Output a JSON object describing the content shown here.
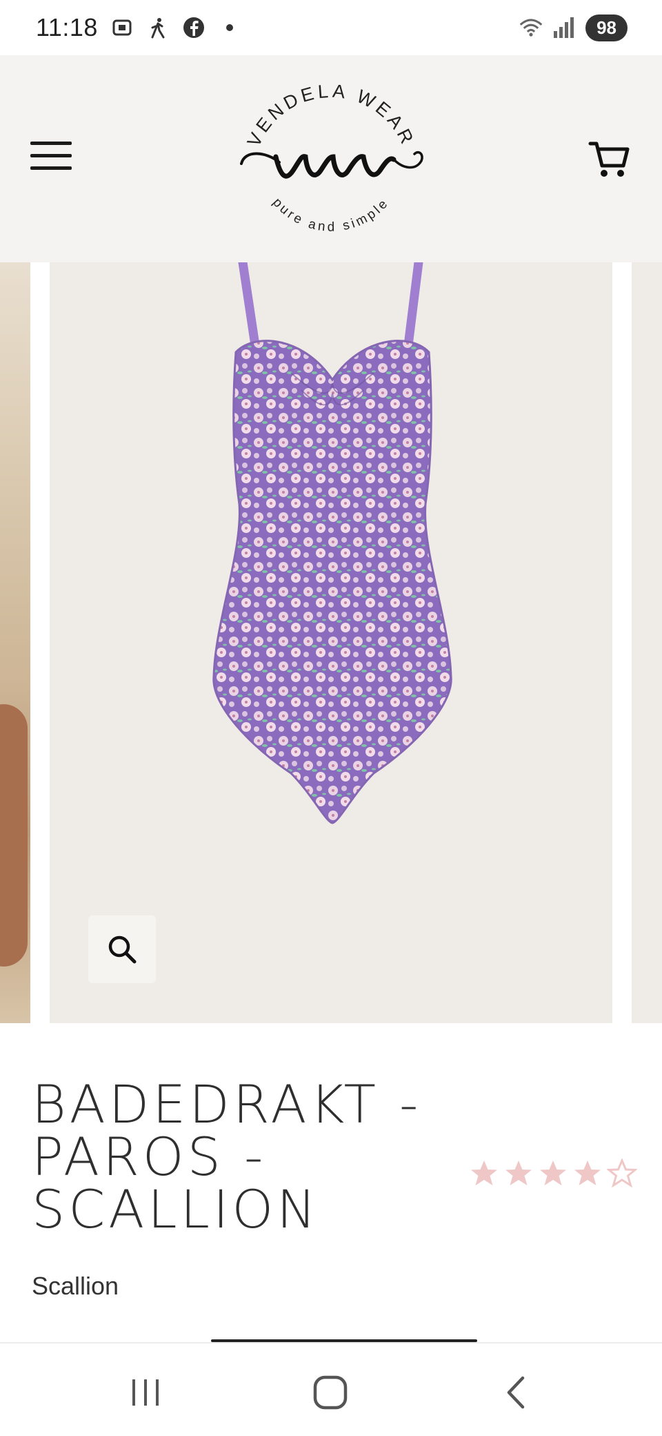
{
  "status_bar": {
    "time": "11:18",
    "battery": "98",
    "icons": [
      "screenshot-icon",
      "walking-icon",
      "facebook-icon",
      "dot-icon",
      "wifi-icon",
      "signal-icon"
    ]
  },
  "header": {
    "logo_top_text": "VENDELA WEAR",
    "logo_bottom_text": "pure and simple",
    "menu_icon": "hamburger-icon",
    "cart_icon": "cart-icon"
  },
  "gallery": {
    "main_image": "floral-swimsuit",
    "zoom_icon": "search-icon"
  },
  "product": {
    "title_lines": [
      "BADEDRAKT -",
      "PAROS -",
      "SCALLION"
    ],
    "rating": 4,
    "rating_max": 5,
    "star_color": "#efc7c7",
    "variant": "Scallion"
  },
  "nav_bar": {
    "icons": [
      "recent-apps-icon",
      "home-icon",
      "back-icon"
    ]
  }
}
